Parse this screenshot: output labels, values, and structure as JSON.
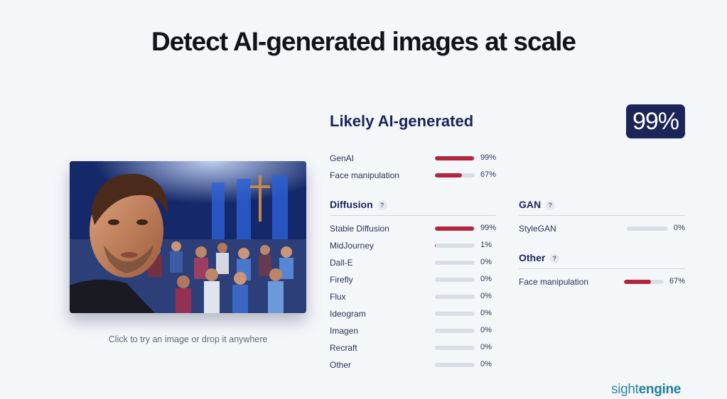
{
  "headline": "Detect AI-generated images at scale",
  "image": {
    "caption": "Click to try an image or drop it anywhere"
  },
  "result": {
    "verdict": "Likely AI-generated",
    "score": "99%",
    "top_rows": [
      {
        "label": "GenAI",
        "value": 0.99,
        "pct": "99%"
      },
      {
        "label": "Face manipulation",
        "value": 0.67,
        "pct": "67%"
      }
    ]
  },
  "diffusion": {
    "title": "Diffusion",
    "help": "?",
    "rows": [
      {
        "label": "Stable Diffusion",
        "value": 0.99,
        "pct": "99%"
      },
      {
        "label": "MidJourney",
        "value": 0.01,
        "pct": "1%"
      },
      {
        "label": "Dall-E",
        "value": 0,
        "pct": "0%"
      },
      {
        "label": "Firefly",
        "value": 0,
        "pct": "0%"
      },
      {
        "label": "Flux",
        "value": 0,
        "pct": "0%"
      },
      {
        "label": "Ideogram",
        "value": 0,
        "pct": "0%"
      },
      {
        "label": "Imagen",
        "value": 0,
        "pct": "0%"
      },
      {
        "label": "Recraft",
        "value": 0,
        "pct": "0%"
      },
      {
        "label": "Other",
        "value": 0,
        "pct": "0%"
      }
    ]
  },
  "gan": {
    "title": "GAN",
    "help": "?",
    "rows": [
      {
        "label": "StyleGAN",
        "value": 0,
        "pct": "0%"
      }
    ]
  },
  "other": {
    "title": "Other",
    "help": "?",
    "rows": [
      {
        "label": "Face manipulation",
        "value": 0.67,
        "pct": "67%"
      }
    ]
  },
  "brand": {
    "part1": "sight",
    "part2": "engine"
  },
  "colors": {
    "bar_fill": "#b3253f",
    "bar_track": "#d9dee6",
    "badge": "#1c2458",
    "brand": "#2a8aa0"
  }
}
